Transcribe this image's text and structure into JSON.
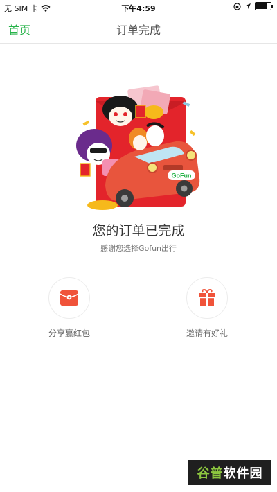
{
  "status_bar": {
    "carrier": "无 SIM 卡",
    "time": "下午4:59",
    "battery_level": 0.85
  },
  "nav": {
    "home_label": "首页",
    "title": "订单完成"
  },
  "main": {
    "done_title": "您的订单已完成",
    "done_subtitle": "感谢您选择Gofun出行",
    "illustration_logo_text": "GoFun"
  },
  "actions": [
    {
      "label": "分享赢红包",
      "icon": "red-envelope-icon"
    },
    {
      "label": "邀请有好礼",
      "icon": "gift-icon"
    }
  ],
  "watermark": {
    "accent": "谷普",
    "rest": "软件园"
  },
  "colors": {
    "accent_green": "#27b34a",
    "icon_red": "#f0533a"
  }
}
